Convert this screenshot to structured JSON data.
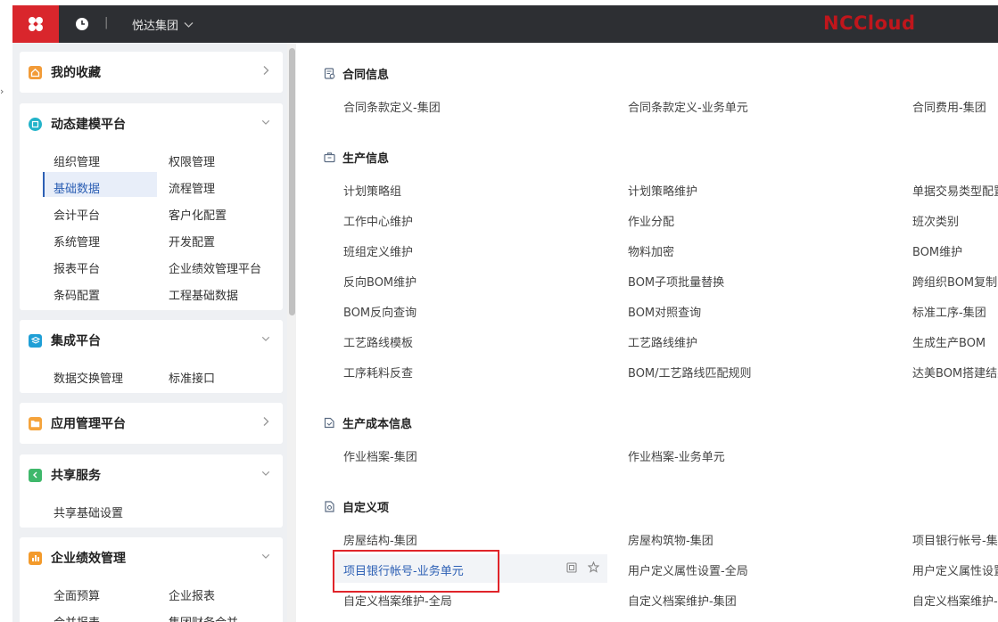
{
  "header": {
    "org_name": "悦达集团",
    "separator": "|",
    "brand": "NCCloud",
    "colors": {
      "bg": "#2d2f33",
      "logo_bg": "#d9262c",
      "brand": "#c0161c"
    }
  },
  "sidebar": {
    "favorites": {
      "title": "我的收藏",
      "icon": "house-icon"
    },
    "dynamic_platform": {
      "title": "动态建模平台",
      "items": [
        "组织管理",
        "权限管理",
        "基础数据",
        "流程管理",
        "会计平台",
        "客户化配置",
        "系统管理",
        "开发配置",
        "报表平台",
        "企业绩效管理平台",
        "条码配置",
        "工程基础数据"
      ],
      "active": "基础数据"
    },
    "integration": {
      "title": "集成平台",
      "items": [
        "数据交换管理",
        "标准接口"
      ]
    },
    "app_mgmt": {
      "title": "应用管理平台"
    },
    "shared": {
      "title": "共享服务",
      "items": [
        "共享基础设置"
      ]
    },
    "performance": {
      "title": "企业绩效管理",
      "items": [
        "全面预算",
        "企业报表",
        "合并报表",
        "集团财务合并"
      ]
    }
  },
  "main": {
    "contract": {
      "title": "合同信息",
      "items": [
        "合同条款定义-集团",
        "合同条款定义-业务单元",
        "合同费用-集团"
      ]
    },
    "production": {
      "title": "生产信息",
      "items": [
        "计划策略组",
        "计划策略维护",
        "单据交易类型配置",
        "工作中心维护",
        "作业分配",
        "班次类别",
        "班组定义维护",
        "物料加密",
        "BOM维护",
        "反向BOM维护",
        "BOM子项批量替换",
        "跨组织BOM复制",
        "BOM反向查询",
        "BOM对照查询",
        "标准工序-集团",
        "工艺路线模板",
        "工艺路线维护",
        "生成生产BOM",
        "工序耗料反查",
        "BOM/工艺路线匹配规则",
        "达美BOM搭建结果"
      ]
    },
    "cost": {
      "title": "生产成本信息",
      "items": [
        "作业档案-集团",
        "作业档案-业务单元"
      ]
    },
    "custom": {
      "title": "自定义项",
      "items": [
        "房屋结构-集团",
        "房屋构筑物-集团",
        "项目银行帐号-集团",
        "项目银行帐号-业务单元",
        "用户定义属性设置-全局",
        "用户定义属性设置",
        "自定义档案维护-全局",
        "自定义档案维护-集团",
        "自定义档案维护-业务单元"
      ]
    }
  }
}
